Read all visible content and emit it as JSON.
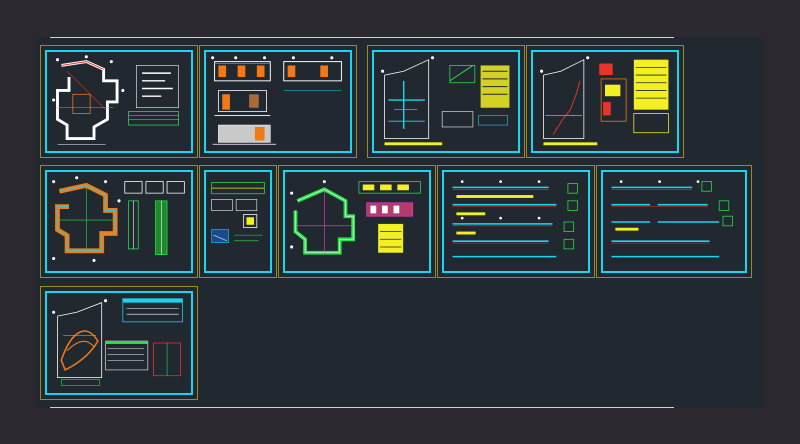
{
  "app": {
    "title": ""
  },
  "colors": {
    "background": "#2b2830",
    "model_space": "#212830",
    "sheet_border": "#9c8a1e",
    "frame": "#19d6f0",
    "line_white": "#ffffff",
    "line_red": "#e8332a",
    "line_orange": "#f07a18",
    "line_green": "#27e04a",
    "line_yellow": "#f2ef22",
    "line_cyan": "#19d6f0",
    "line_magenta": "#ff3bd0"
  },
  "icons": {
    "sheet_marker": "white-dot-icon"
  },
  "sheets": [
    {
      "id": "sheet-1",
      "content": "floor-plan-with-table"
    },
    {
      "id": "sheet-2",
      "content": "elevations-and-sections"
    },
    {
      "id": "sheet-3",
      "content": "sanitary-installation-detail"
    },
    {
      "id": "sheet-4",
      "content": "sanitary-installation-legend"
    },
    {
      "id": "sheet-5",
      "content": "structural-plan-with-columns"
    },
    {
      "id": "sheet-6",
      "content": "structural-details"
    },
    {
      "id": "sheet-7",
      "content": "roof-plan-with-notes"
    },
    {
      "id": "sheet-8",
      "content": "beam-details-a"
    },
    {
      "id": "sheet-9",
      "content": "beam-details-b"
    },
    {
      "id": "sheet-10",
      "content": "electrical-installation-plan"
    }
  ]
}
